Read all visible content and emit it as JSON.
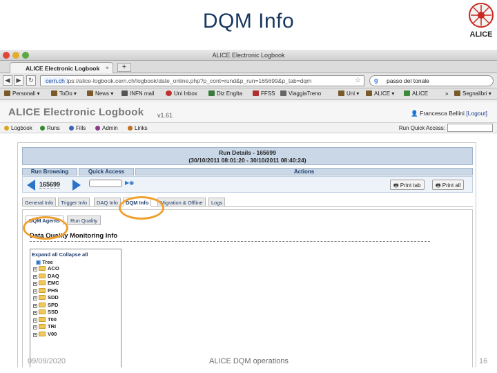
{
  "slide": {
    "title": "DQM Info",
    "logo_text": "ALICE",
    "footer_date": "09/09/2020",
    "footer_center": "ALICE DQM operations",
    "page_number": "16"
  },
  "browser": {
    "window_title": "ALICE Electronic Logbook",
    "tab_label": "ALICE Electronic Logbook",
    "tab_close": "×",
    "new_tab": "+",
    "url_domain": "cern.ch",
    "url": "https://alice-logbook.cern.ch/logbook/date_online.php?p_cont=rund&p_run=165699&p_tab=dqm",
    "search_value": "passo del tonale",
    "bookmarks": [
      "Personali ▾",
      "ToDo ▾",
      "News ▾",
      "INFN mail",
      "Uni Inbox",
      "Diz EngIta",
      "FFSS",
      "ViaggiaTreno",
      "Uni ▾",
      "ALICE ▾",
      "ALICE",
      "» ",
      "Segnalibri ▾"
    ]
  },
  "app": {
    "title": "ALICE Electronic Logbook",
    "version": "v1.61",
    "user": "Francesca Bellini",
    "logout": "[Logout]",
    "menu": [
      "Logbook",
      "Runs",
      "Fills",
      "Admin",
      "Links"
    ],
    "quick_access_label": "Run Quick Access:"
  },
  "run": {
    "details_title": "Run Details - 165699",
    "details_range": "(30/10/2011 08:01:20 - 30/10/2011 08:40:24)",
    "run_browsing": "Run Browsing",
    "quick_access": "Quick Access",
    "actions": "Actions",
    "run_number": "165699",
    "print_tab": "Print tab",
    "print_all": "Print all"
  },
  "tabs": [
    "General Info",
    "Trigger Info",
    "DAQ Info",
    "DQM Info",
    "Migration & Offline",
    "Logs"
  ],
  "subtabs": [
    "DQM Agents",
    "Run Quality"
  ],
  "dqm": {
    "section_title": "Data Quality Monitoring Info",
    "expand": "Expand all",
    "collapse": "Collapse all",
    "tree_root": "Tree",
    "items": [
      "ACO",
      "DAQ",
      "EMC",
      "PHS",
      "SDD",
      "SPD",
      "SSD",
      "T00",
      "TRI",
      "V00"
    ]
  },
  "colors": {
    "highlight": "#f0a030",
    "title": "#17375e",
    "header_blue": "#c9d7e6"
  }
}
